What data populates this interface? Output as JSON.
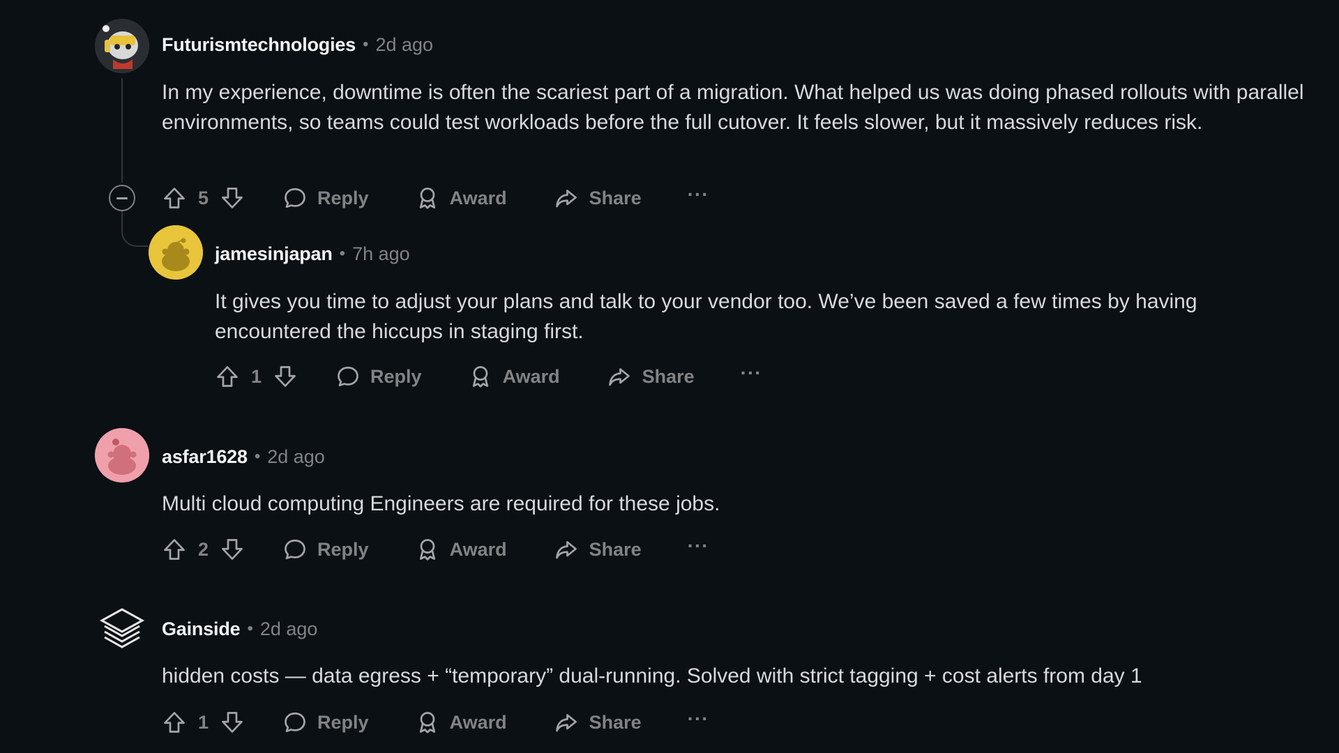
{
  "comments": [
    {
      "author": "Futurismtechnologies",
      "time": "2d ago",
      "body": "In my experience, downtime is often the scariest part of a migration. What helped us was doing phased rollouts with parallel environments, so teams could test workloads before the full cutover. It feels slower, but it massively reduces risk.",
      "score": "5",
      "avatar_icon": "robot-mascot-avatar",
      "avatar_color": "#2a2e33"
    },
    {
      "author": "jamesinjapan",
      "time": "7h ago",
      "body": "It gives you time to adjust your plans and talk to your vendor too. We’ve been saved a few times by having encountered the hiccups in staging first.",
      "score": "1",
      "avatar_icon": "snoo-avatar-yellow",
      "avatar_color": "#e8c53a"
    },
    {
      "author": "asfar1628",
      "time": "2d ago",
      "body": "Multi cloud computing Engineers are required for these jobs.",
      "score": "2",
      "avatar_icon": "snoo-avatar-pink",
      "avatar_color": "#f0a0aa"
    },
    {
      "author": "Gainside",
      "time": "2d ago",
      "body": "hidden costs — data egress + “temporary” dual-running. Solved with strict tagging + cost alerts from day 1",
      "score": "1",
      "avatar_icon": "stacked-layers-logo",
      "avatar_color": "#0b1015"
    }
  ],
  "actions": {
    "reply": "Reply",
    "award": "Award",
    "share": "Share",
    "more": "···"
  },
  "separator": "•"
}
